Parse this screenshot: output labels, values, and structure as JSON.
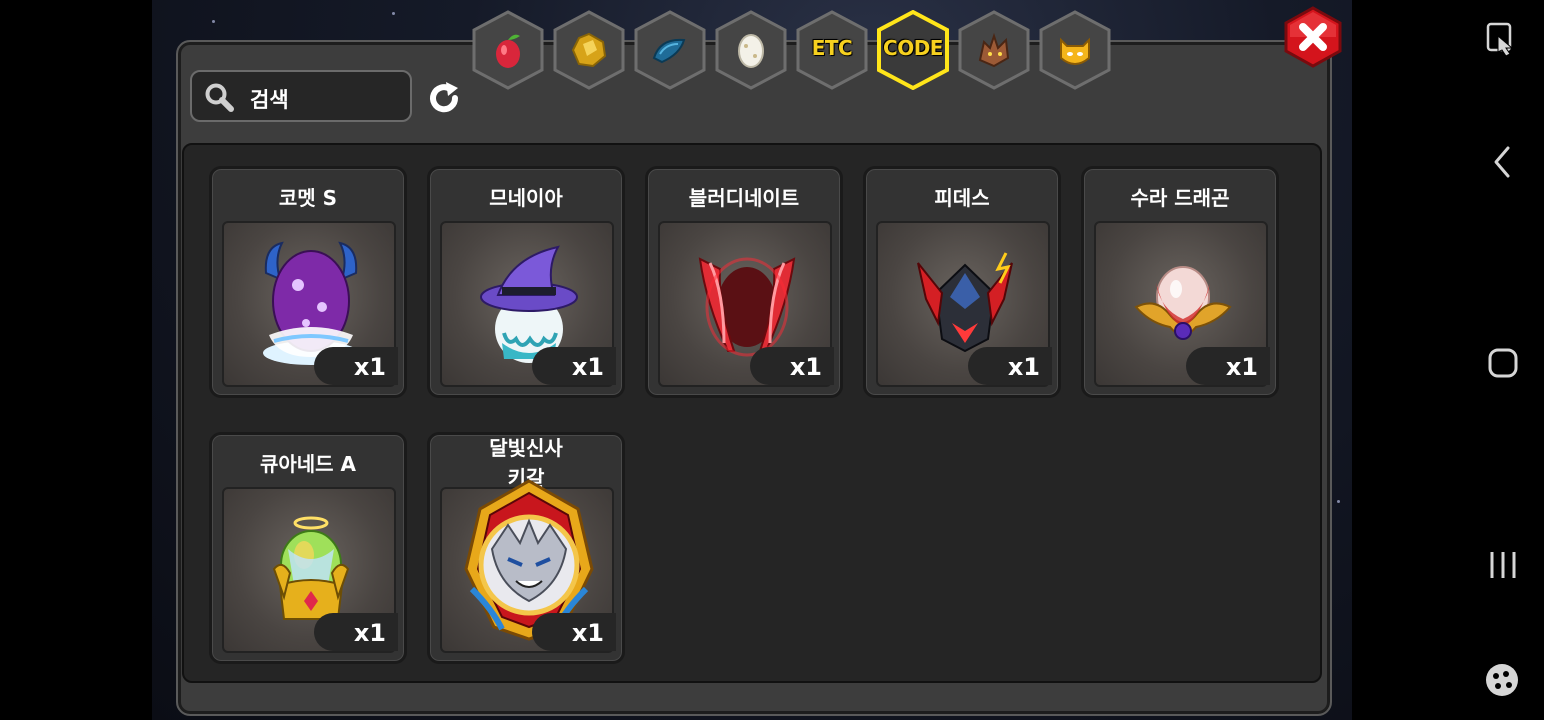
{
  "search": {
    "placeholder": "검색"
  },
  "tabs": [
    {
      "name": "fruit",
      "label": "",
      "icon": "red-fruit-icon"
    },
    {
      "name": "gold-stone",
      "label": "",
      "icon": "gold-ore-icon"
    },
    {
      "name": "scale",
      "label": "",
      "icon": "blue-scale-icon"
    },
    {
      "name": "egg",
      "label": "",
      "icon": "egg-icon"
    },
    {
      "name": "etc",
      "label": "ETC",
      "icon": ""
    },
    {
      "name": "code",
      "label": "CODE",
      "icon": "",
      "selected": true
    },
    {
      "name": "dragon",
      "label": "",
      "icon": "dragon-head-icon"
    },
    {
      "name": "monster",
      "label": "",
      "icon": "yellow-monster-icon"
    }
  ],
  "items": [
    {
      "name": "코멧 S",
      "qty": "x1",
      "art": "comet-egg"
    },
    {
      "name": "므네이아",
      "qty": "x1",
      "art": "witch-hat-egg"
    },
    {
      "name": "블러디네이트",
      "qty": "x1",
      "art": "crimson-egg"
    },
    {
      "name": "피데스",
      "qty": "x1",
      "art": "dark-armor-egg"
    },
    {
      "name": "수라 드래곤",
      "qty": "x1",
      "art": "pearl-egg"
    },
    {
      "name": "큐아네드 A",
      "qty": "x1",
      "art": "golden-lantern-egg"
    },
    {
      "name": "달빛신사\n키갈",
      "line1": "달빛신사",
      "line2": "키갈",
      "qty": "x1",
      "art": "wolf-emblem"
    }
  ],
  "colors": {
    "tab_selected_border": "#ffe51a",
    "tab_label": "#f7d11f",
    "close_red": "#d4141c"
  }
}
